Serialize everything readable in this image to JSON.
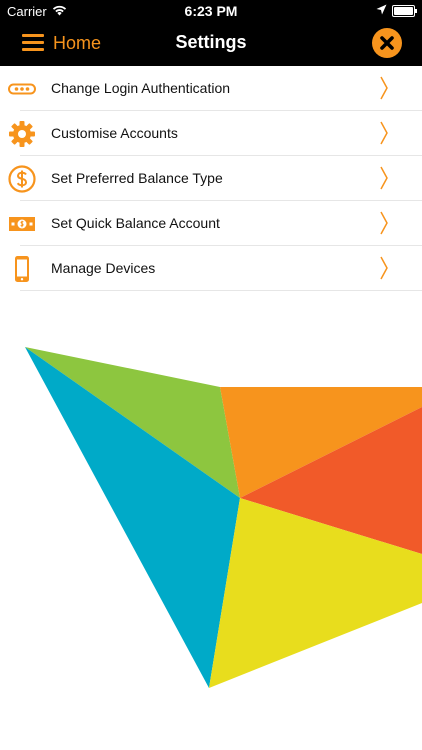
{
  "status": {
    "carrier": "Carrier",
    "time": "6:23 PM"
  },
  "header": {
    "back_label": "Home",
    "title": "Settings"
  },
  "colors": {
    "accent": "#f7941d",
    "bar": "#000000"
  },
  "settings": [
    {
      "label": "Change Login Authentication",
      "icon": "password-dots-icon"
    },
    {
      "label": "Customise Accounts",
      "icon": "gear-icon"
    },
    {
      "label": "Set Preferred Balance Type",
      "icon": "dollar-circle-icon"
    },
    {
      "label": "Set Quick Balance Account",
      "icon": "banknote-icon"
    },
    {
      "label": "Manage Devices",
      "icon": "smartphone-icon"
    }
  ]
}
